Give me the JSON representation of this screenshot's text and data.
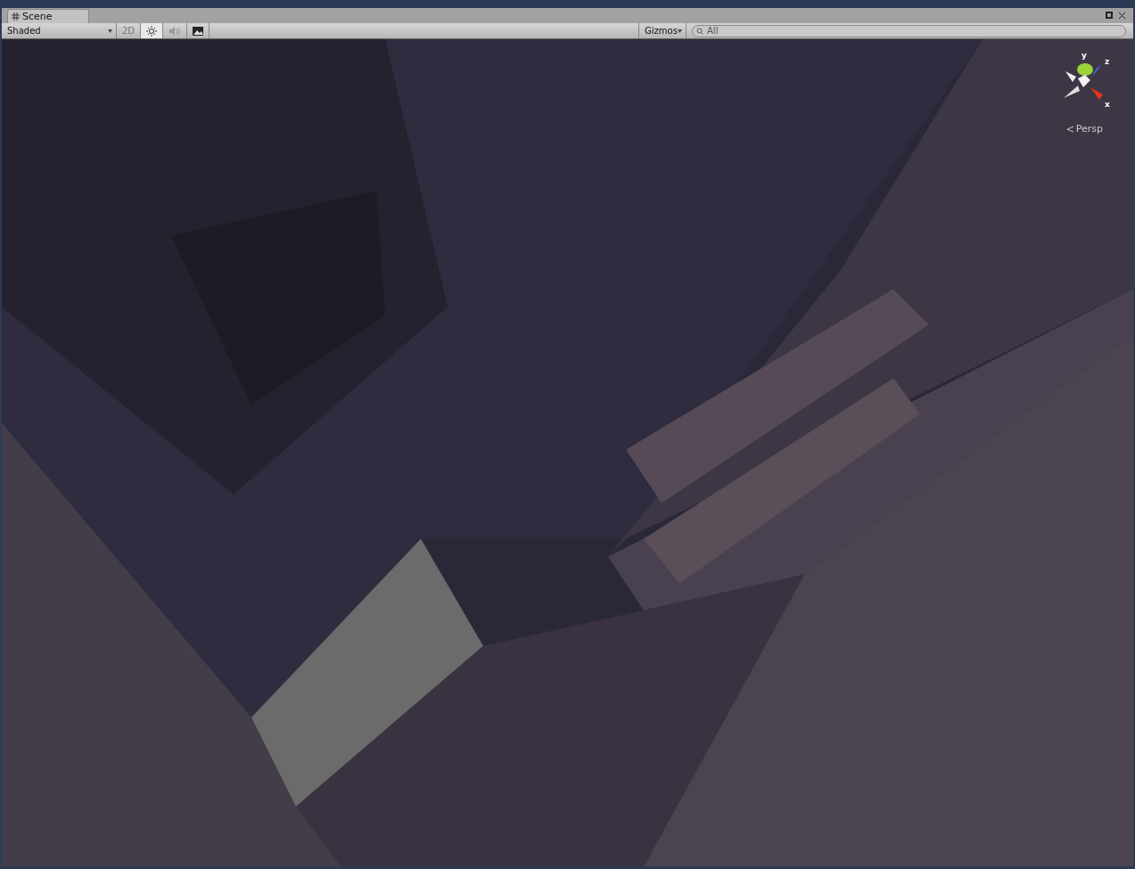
{
  "tab": {
    "label": "Scene",
    "selected": true
  },
  "toolbar": {
    "draw_mode": "Shaded",
    "toggles": [
      {
        "kind": "text",
        "label": "2D",
        "selected": false
      },
      {
        "kind": "light",
        "selected": true
      },
      {
        "kind": "audio",
        "selected": false
      },
      {
        "kind": "effects",
        "selected": false
      }
    ],
    "gizmos": "Gizmos",
    "search": {
      "placeholder": "All"
    }
  },
  "viewport": {
    "axes": [
      {
        "label": "y"
      },
      {
        "label": "z"
      },
      {
        "label": "x"
      }
    ],
    "projection": "Persp"
  }
}
